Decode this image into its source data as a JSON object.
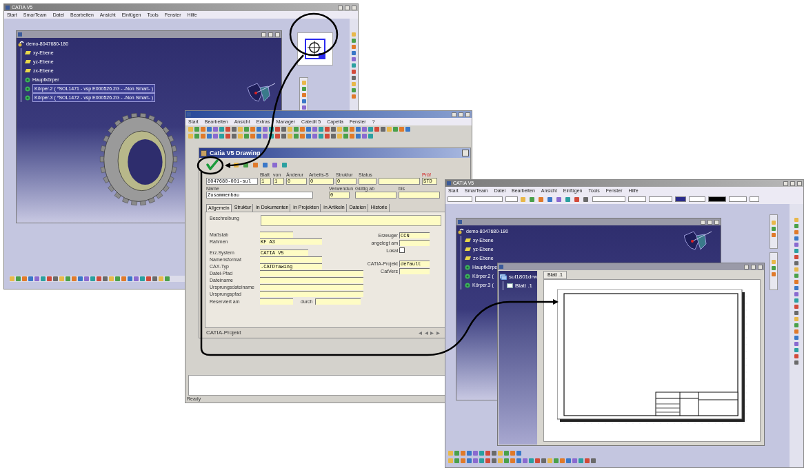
{
  "catia_window_left": {
    "title": "CATIA V5",
    "menu": [
      "Start",
      "SmarTeam",
      "Datei",
      "Bearbeiten",
      "Ansicht",
      "Einfügen",
      "Tools",
      "Fenster",
      "Hilfe"
    ],
    "tree": [
      {
        "label": "demo-8047680-180",
        "kind": "product",
        "selected": false,
        "children": [
          {
            "label": "xy-Ebene",
            "kind": "plane",
            "selected": false
          },
          {
            "label": "yz-Ebene",
            "kind": "plane",
            "selected": false
          },
          {
            "label": "zx-Ebene",
            "kind": "plane",
            "selected": false
          },
          {
            "label": "Hauptkörper",
            "kind": "body",
            "selected": false
          },
          {
            "label": "Körper.2 ( *SOL1471 - vsp E000526.2G - -Non Smart- )",
            "kind": "body",
            "selected": true
          },
          {
            "label": "Körper.3 ( *SOL1472 - vsp E000526.2G - -Non Smart- )",
            "kind": "body",
            "selected": true
          }
        ]
      }
    ]
  },
  "plm_window": {
    "menu": [
      "Start",
      "Bearbeiten",
      "Ansicht",
      "Extras",
      "Manager",
      "Catedit 5",
      "Capella",
      "Fenster",
      "?"
    ],
    "dialog": {
      "title": "Catia V5 Drawing",
      "header_row_1": [
        {
          "value": "8047680-001-sul"
        },
        {
          "label": "Blatt",
          "value": "1"
        },
        {
          "label": "von",
          "value": "1"
        },
        {
          "label": "Änderur",
          "value": "0"
        },
        {
          "label": "Arbeits-S",
          "value": "0"
        },
        {
          "label": "Struktur",
          "value": "0"
        },
        {
          "label": "Status",
          "second_field": true
        },
        {
          "label": "Prüf",
          "value": "STD",
          "alert": true
        }
      ],
      "header_row_2": [
        {
          "label": "Name",
          "value": "Zusammenbau"
        },
        {
          "label": "Verwendun",
          "value": "0"
        },
        {
          "label": "Gültig ab"
        },
        {
          "label": "bis"
        }
      ],
      "tabs": [
        {
          "label": "Allgemein",
          "selected": true
        },
        {
          "label": "Struktur",
          "selected": false
        },
        {
          "label": "in Dokumenten",
          "selected": false
        },
        {
          "label": "in Projekten",
          "selected": false
        },
        {
          "label": "in Artikeln",
          "selected": false
        },
        {
          "label": "Dateien",
          "selected": false
        },
        {
          "label": "Historie",
          "selected": false
        }
      ],
      "description_label": "Beschreibung",
      "left_fields": [
        {
          "label": "Maßstab"
        },
        {
          "label": "Rahmen",
          "value": "KF A3"
        },
        {
          "label": "Erz.System",
          "value": "CATIA V5"
        },
        {
          "label": "Namensformat"
        },
        {
          "label": "CAX-Typ",
          "value": ".CATDrawing"
        },
        {
          "label": "Datei-Pfad"
        },
        {
          "label": "Dateiname"
        },
        {
          "label": "Ursprungsdateiname"
        },
        {
          "label": "Ursprungspfad"
        }
      ],
      "reserved": {
        "label": "Reserviert am",
        "by_label": "durch"
      },
      "right_fields": [
        {
          "label": "Erzeuger",
          "value": "CCN",
          "kind": "text"
        },
        {
          "label": "angelegt am",
          "kind": "text"
        },
        {
          "label": "Lokal",
          "kind": "checkbox",
          "checked": false
        },
        {
          "label": "CATIA-Projekt",
          "value": "default",
          "kind": "text"
        },
        {
          "label": "CatVers",
          "kind": "text"
        }
      ],
      "footer": "CATIA-Projekt"
    },
    "status_bar": "Ready"
  },
  "catia_window_right": {
    "title": "CATIA V5",
    "menu": [
      "Start",
      "SmarTeam",
      "Datei",
      "Bearbeiten",
      "Ansicht",
      "Einfügen",
      "Tools",
      "Fenster",
      "Hilfe"
    ],
    "tree": [
      {
        "label": "demo-8047680-180",
        "kind": "product",
        "selected": false,
        "children": [
          {
            "label": "xy-Ebene",
            "kind": "plane",
            "selected": false
          },
          {
            "label": "yz-Ebene",
            "kind": "plane",
            "selected": false
          },
          {
            "label": "zx-Ebene",
            "kind": "plane",
            "selected": false
          },
          {
            "label": "Hauptkörpe",
            "kind": "body",
            "selected": false
          },
          {
            "label": "Körper.2 (",
            "kind": "body",
            "selected": false
          },
          {
            "label": "Körper.3 (",
            "kind": "body",
            "selected": false
          }
        ]
      }
    ],
    "drawing": {
      "tree": [
        {
          "label": "sul1801drw",
          "kind": "drawing",
          "selected": false,
          "children": [
            {
              "label": "Blatt .1",
              "kind": "sheet",
              "selected": false
            }
          ]
        }
      ],
      "tabs": [
        {
          "label": "Blatt .1",
          "selected": true
        }
      ]
    }
  }
}
